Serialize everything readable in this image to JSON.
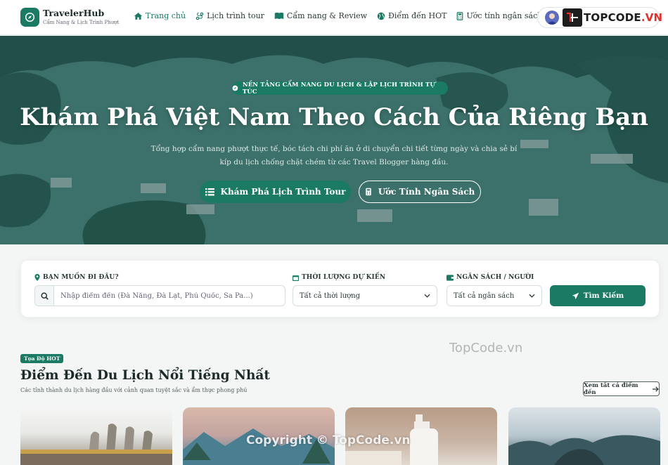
{
  "brand": {
    "name": "TravelerHub",
    "tagline": "Cẩm Nang & Lịch Trình Phượt"
  },
  "nav": [
    {
      "label": "Trang chủ",
      "icon": "home-icon",
      "active": true
    },
    {
      "label": "Lịch trình tour",
      "icon": "route-icon",
      "active": false
    },
    {
      "label": "Cẩm nang & Review",
      "icon": "book-icon",
      "active": false
    },
    {
      "label": "Điểm đến HOT",
      "icon": "globe-icon",
      "active": false
    },
    {
      "label": "Ước tính ngân sách",
      "icon": "calculator-icon",
      "active": false
    }
  ],
  "watermark": {
    "logo_text_1": "TOPCODE",
    "logo_text_2": ".VN",
    "mid": "TopCode.vn",
    "bottom": "Copyright © TopCode.vn"
  },
  "hero": {
    "badge": "NỀN TẢNG CẨM NANG DU LỊCH & LẬP LỊCH TRÌNH TỰ TÚC",
    "title": "Khám Phá Việt Nam Theo Cách Của Riêng Bạn",
    "description": "Tổng hợp cẩm nang phượt thực tế, bóc tách chi phí ăn ở di chuyển chi tiết từng ngày và chia sẻ bí kíp du lịch chống chặt chém từ các Travel Blogger hàng đầu.",
    "primary_button": "Khám Phá Lịch Trình Tour",
    "secondary_button": "Ước Tính Ngân Sách"
  },
  "search": {
    "destination_label": "BẠN MUỐN ĐI ĐÂU?",
    "destination_placeholder": "Nhập điểm đến (Đà Nẵng, Đà Lạt, Phú Quốc, Sa Pa...)",
    "duration_label": "THỜI LƯỢNG DỰ KIẾN",
    "duration_value": "Tất cả thời lượng",
    "budget_label": "NGÂN SÁCH / NGƯỜI",
    "budget_value": "Tất cả ngân sách",
    "submit": "Tìm Kiếm"
  },
  "section": {
    "badge": "Tọa Độ HOT",
    "title": "Điểm Đến Du Lịch Nổi Tiếng Nhất",
    "subtitle": "Các tỉnh thành du lịch hàng đầu với cảnh quan tuyệt sắc và ẩm thực phong phú",
    "view_all": "Xem tất cả điểm đến"
  },
  "colors": {
    "accent": "#1a7a64",
    "text": "#1c2a2a",
    "background": "#f4f6f6"
  }
}
